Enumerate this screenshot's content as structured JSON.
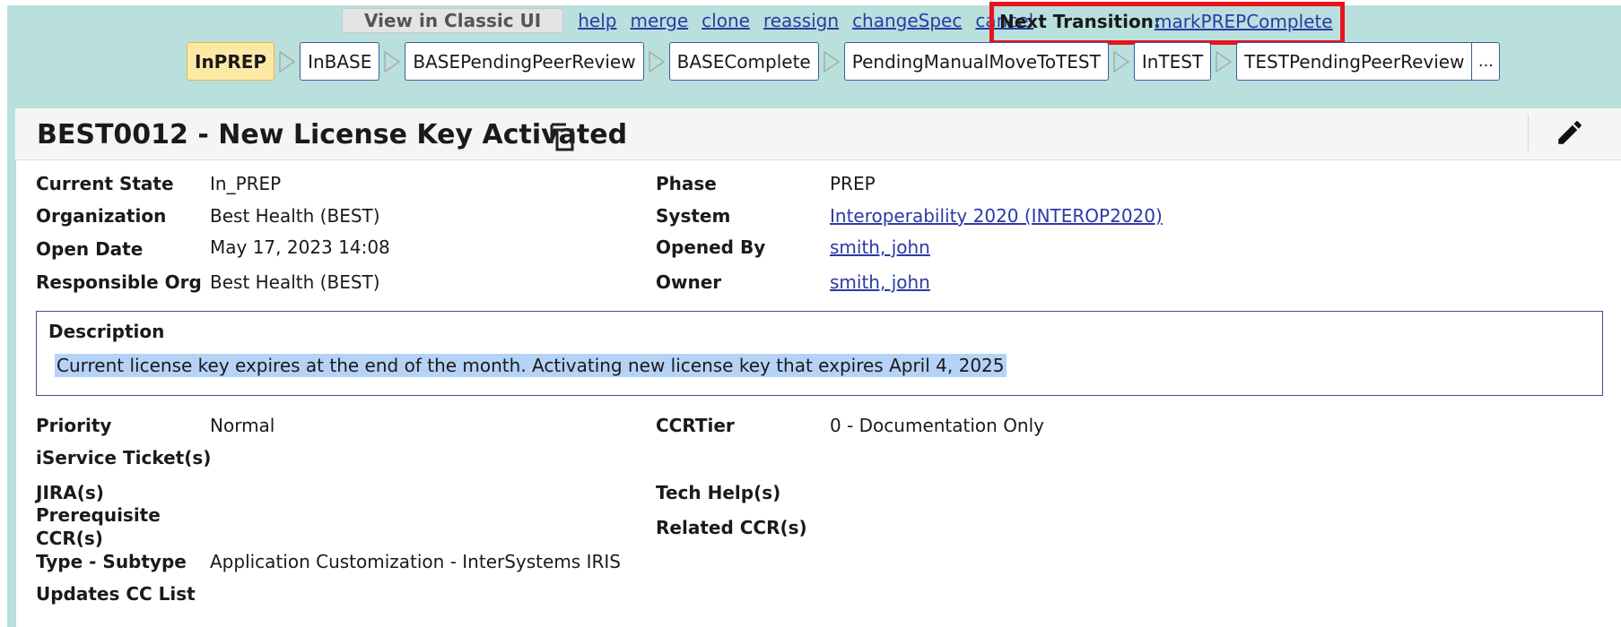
{
  "toolbar": {
    "classic_button": "View in Classic UI",
    "links": [
      "help",
      "merge",
      "clone",
      "reassign",
      "changeSpec",
      "cancel"
    ],
    "next_transition_label": "Next Transition:",
    "next_transition_link": "markPREPComplete"
  },
  "states": {
    "items": [
      "InPREP",
      "InBASE",
      "BASEPendingPeerReview",
      "BASEComplete",
      "PendingManualMoveToTEST",
      "InTEST",
      "TESTPendingPeerReview"
    ],
    "active": "InPREP",
    "more": "..."
  },
  "header": {
    "title": "BEST0012 - New License Key Activated",
    "copy_icon": "copy-icon",
    "edit_icon": "pencil-icon"
  },
  "fields": {
    "current_state": {
      "label": "Current State",
      "value": "In_PREP"
    },
    "organization": {
      "label": "Organization",
      "value": "Best Health (BEST)"
    },
    "open_date": {
      "label": "Open Date",
      "value": "May 17, 2023 14:08"
    },
    "responsible_org": {
      "label": "Responsible Org",
      "value": "Best Health (BEST)"
    },
    "phase": {
      "label": "Phase",
      "value": "PREP"
    },
    "system": {
      "label": "System",
      "value": "Interoperability 2020 (INTEROP2020)"
    },
    "opened_by": {
      "label": "Opened By",
      "value": "smith, john"
    },
    "owner": {
      "label": "Owner",
      "value": "smith, john"
    }
  },
  "description": {
    "title": "Description",
    "text": "Current license key expires at the end of the month. Activating new license key that expires April 4, 2025"
  },
  "details": {
    "priority": {
      "label": "Priority",
      "value": "Normal"
    },
    "iservice": {
      "label": "iService Ticket(s)"
    },
    "jira": {
      "label": "JIRA(s)"
    },
    "prereq_line1": "Prerequisite",
    "prereq_line2": "CCR(s)",
    "type_subtype": {
      "label": "Type - Subtype",
      "value": "Application Customization - InterSystems IRIS"
    },
    "updates_cc": {
      "label": "Updates CC List"
    },
    "ccr_tier": {
      "label": "CCRTier",
      "value": "0 - Documentation Only"
    },
    "tech_help": {
      "label": "Tech Help(s)"
    },
    "related_ccr": {
      "label": "Related CCR(s)"
    }
  },
  "colors": {
    "header_bg": "#b9e0dd",
    "link": "#2b3aa6",
    "highlight_box": "#e8141c",
    "active_state_bg": "#fde9a6"
  }
}
